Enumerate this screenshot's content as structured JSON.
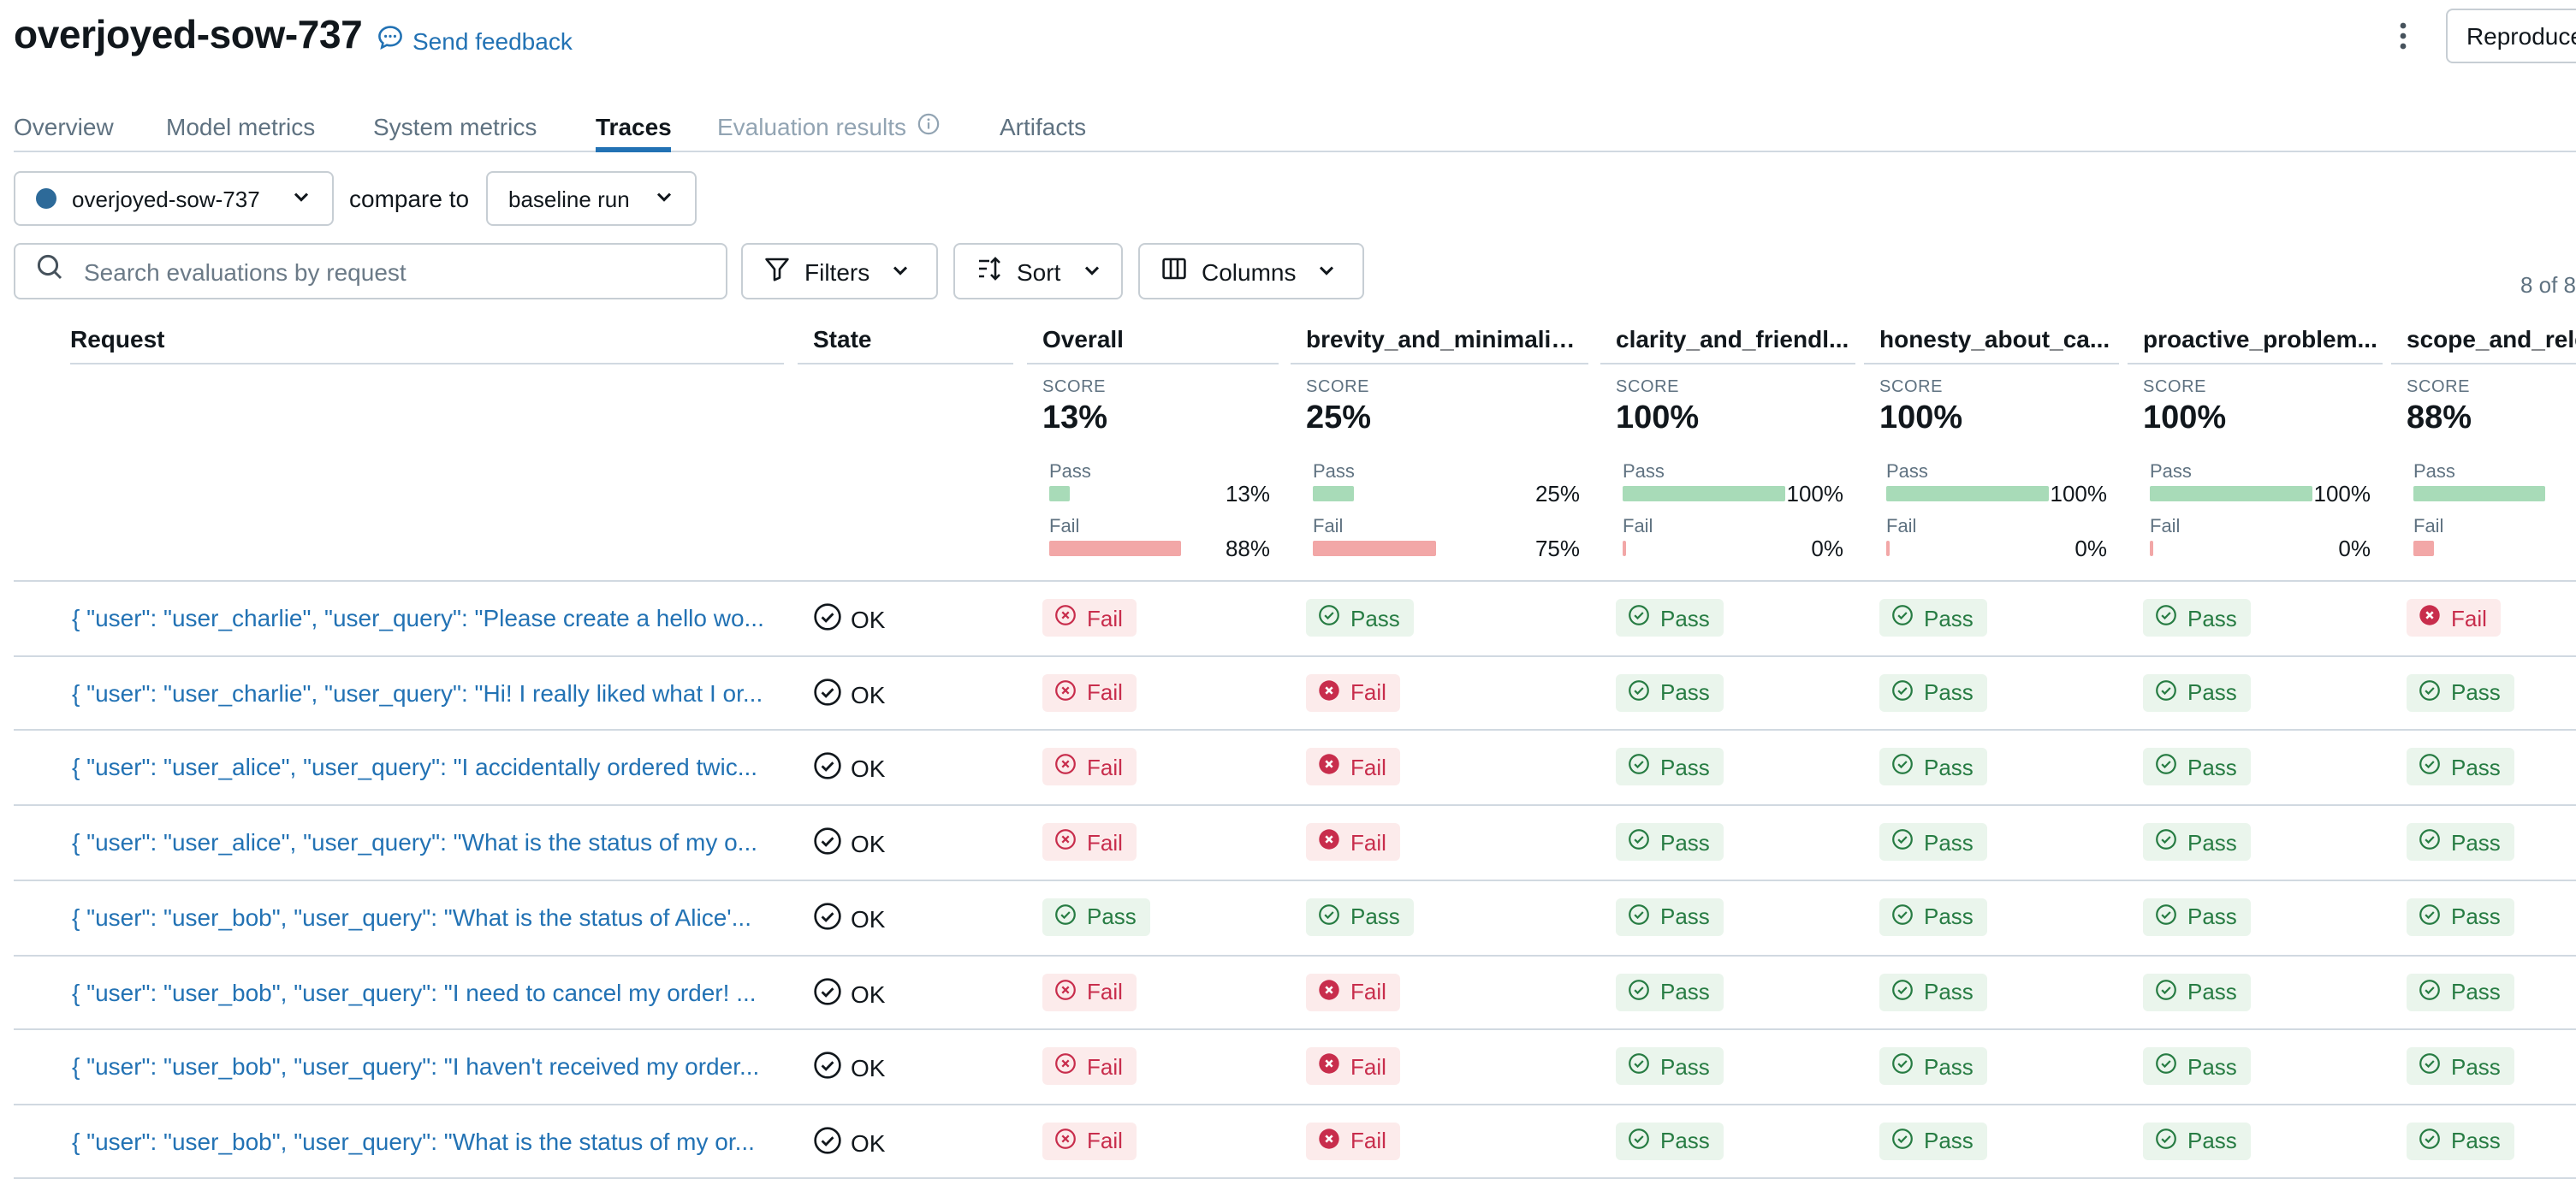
{
  "header": {
    "run_name": "overjoyed-sow-737",
    "feedback_label": "Send feedback",
    "reproduce_label": "Reproduce Run"
  },
  "tabs": [
    {
      "label": "Overview",
      "state": "normal"
    },
    {
      "label": "Model metrics",
      "state": "normal"
    },
    {
      "label": "System metrics",
      "state": "normal"
    },
    {
      "label": "Traces",
      "state": "active"
    },
    {
      "label": "Evaluation results",
      "state": "disabled"
    },
    {
      "label": "Artifacts",
      "state": "normal"
    }
  ],
  "run_select": {
    "value": "overjoyed-sow-737",
    "compare_label": "compare to",
    "baseline_value": "baseline run",
    "run_color": "#2d6a99"
  },
  "toolbar": {
    "search_placeholder": "Search evaluations by request",
    "filters_label": "Filters",
    "sort_label": "Sort",
    "columns_label": "Columns",
    "count_text": "8 of 8"
  },
  "columns": {
    "request": "Request",
    "state": "State",
    "metrics": [
      {
        "label": "Overall",
        "score_label": "SCORE",
        "score": "13%",
        "pass_label": "Pass",
        "pass_pct": "13%",
        "pass_value": 0.13,
        "fail_label": "Fail",
        "fail_pct": "88%",
        "fail_value": 0.88
      },
      {
        "label": "brevity_and_minimalism",
        "score_label": "SCORE",
        "score": "25%",
        "pass_label": "Pass",
        "pass_pct": "25%",
        "pass_value": 0.25,
        "fail_label": "Fail",
        "fail_pct": "75%",
        "fail_value": 0.75
      },
      {
        "label": "clarity_and_friendl...",
        "score_label": "SCORE",
        "score": "100%",
        "pass_label": "Pass",
        "pass_pct": "100%",
        "pass_value": 1.0,
        "fail_label": "Fail",
        "fail_pct": "0%",
        "fail_value": 0.0
      },
      {
        "label": "honesty_about_ca...",
        "score_label": "SCORE",
        "score": "100%",
        "pass_label": "Pass",
        "pass_pct": "100%",
        "pass_value": 1.0,
        "fail_label": "Fail",
        "fail_pct": "0%",
        "fail_value": 0.0
      },
      {
        "label": "proactive_problem...",
        "score_label": "SCORE",
        "score": "100%",
        "pass_label": "Pass",
        "pass_pct": "100%",
        "pass_value": 1.0,
        "fail_label": "Fail",
        "fail_pct": "0%",
        "fail_value": 0.0
      },
      {
        "label": "scope_and_releva...",
        "score_label": "SCORE",
        "score": "88%",
        "pass_label": "Pass",
        "pass_pct": "88%",
        "pass_value": 0.88,
        "fail_label": "Fail",
        "fail_pct": "13%",
        "fail_value": 0.13
      }
    ]
  },
  "colors": {
    "pass_bar": "#a8dbb8",
    "fail_bar": "#f2a7a7",
    "link": "#2272b4"
  },
  "rows": [
    {
      "request": "{ \"user\": \"user_charlie\", \"user_query\": \"Please create a hello wo...",
      "state": "OK",
      "results": [
        "Fail",
        "Pass",
        "Pass",
        "Pass",
        "Pass",
        "Fail"
      ]
    },
    {
      "request": "{ \"user\": \"user_charlie\", \"user_query\": \"Hi! I really liked what I or...",
      "state": "OK",
      "results": [
        "Fail",
        "Fail",
        "Pass",
        "Pass",
        "Pass",
        "Pass"
      ]
    },
    {
      "request": "{ \"user\": \"user_alice\", \"user_query\": \"I accidentally ordered twic...",
      "state": "OK",
      "results": [
        "Fail",
        "Fail",
        "Pass",
        "Pass",
        "Pass",
        "Pass"
      ]
    },
    {
      "request": "{ \"user\": \"user_alice\", \"user_query\": \"What is the status of my o...",
      "state": "OK",
      "results": [
        "Fail",
        "Fail",
        "Pass",
        "Pass",
        "Pass",
        "Pass"
      ]
    },
    {
      "request": "{ \"user\": \"user_bob\", \"user_query\": \"What is the status of Alice'...",
      "state": "OK",
      "results": [
        "Pass",
        "Pass",
        "Pass",
        "Pass",
        "Pass",
        "Pass"
      ]
    },
    {
      "request": "{ \"user\": \"user_bob\", \"user_query\": \"I need to cancel my order! ...",
      "state": "OK",
      "results": [
        "Fail",
        "Fail",
        "Pass",
        "Pass",
        "Pass",
        "Pass"
      ]
    },
    {
      "request": "{ \"user\": \"user_bob\", \"user_query\": \"I haven't received my order...",
      "state": "OK",
      "results": [
        "Fail",
        "Fail",
        "Pass",
        "Pass",
        "Pass",
        "Pass"
      ]
    },
    {
      "request": "{ \"user\": \"user_bob\", \"user_query\": \"What is the status of my or...",
      "state": "OK",
      "results": [
        "Fail",
        "Fail",
        "Pass",
        "Pass",
        "Pass",
        "Pass"
      ]
    }
  ]
}
